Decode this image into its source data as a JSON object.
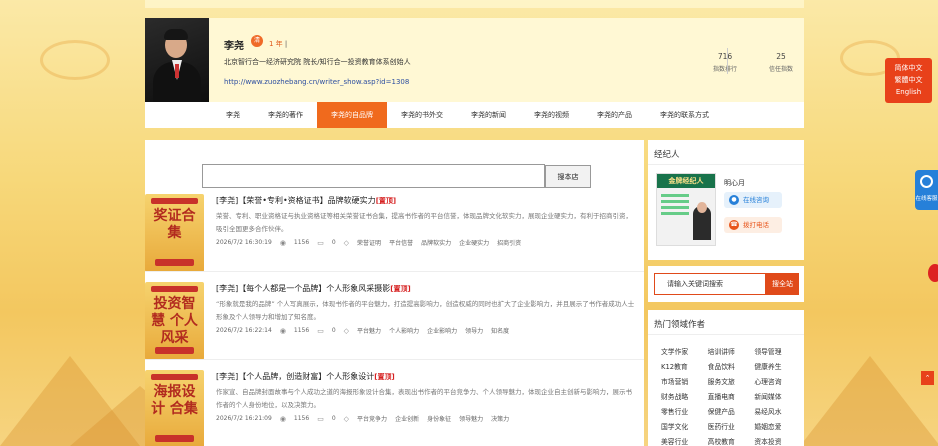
{
  "profile": {
    "name": "李尧",
    "badge": "清",
    "years": "1 年",
    "years_sep": "|",
    "description": "北京智行合一经济研究院 院长/知行合一投资教育体系创始人",
    "url": "http://www.zuozhebang.cn/writer_show.asp?id=1308",
    "stats": [
      {
        "value": "716",
        "label": "指数排行"
      },
      {
        "value": "25",
        "label": "信任指数"
      }
    ]
  },
  "nav": {
    "items": [
      "李尧",
      "李尧的著作",
      "李尧的自品牌",
      "李尧的书外交",
      "李尧的新闻",
      "李尧的视频",
      "李尧的产品",
      "李尧的联系方式"
    ],
    "active_index": 2
  },
  "search": {
    "placeholder": "",
    "button": "搜本店"
  },
  "articles": [
    {
      "cover": {
        "top": "",
        "main": "奖证合集",
        "bottom": ""
      },
      "title": "[李尧]【荣誉•专利•资格证书】品牌软硬实力",
      "tag": "[置顶]",
      "body": "荣誉、专利、职业资格证与执业资格证等相关荣誉证书合集，提高书作者的平台信誉，体现品牌文化软实力，展现企业硬实力，有利于招商引资，吸引全国更多合作伙伴。",
      "date": "2026/7/2 16:30:19",
      "views": "1156",
      "comments": "0",
      "tags": [
        "荣誉证明",
        "平台信誉",
        "品牌软实力",
        "企业硬实力",
        "招商引资"
      ]
    },
    {
      "cover": {
        "top": "",
        "main": "投资智慧 个人风采",
        "bottom": ""
      },
      "title": "[李尧]【每个人都是一个品牌】个人形象风采摄影",
      "tag": "[置顶]",
      "body": "“形象就是我的品牌” 个人写真展示，体现书作者的平台魅力，打造提高影响力，创造权威的同时也扩大了企业影响力，并且展示了书作者成功人士形象及个人领导力和增加了知名度。",
      "date": "2026/7/2 16:22:14",
      "views": "1156",
      "comments": "0",
      "tags": [
        "平台魅力",
        "个人影响力",
        "企业影响力",
        "领导力",
        "知名度"
      ]
    },
    {
      "cover": {
        "top": "",
        "main": "海报设计 合集",
        "bottom": ""
      },
      "title": "[李尧]【个人品牌，创造财富】个人形象设计",
      "tag": "[置顶]",
      "body": "作家宣、自品牌封面故事与个人成功之道的海报形象设计合集，表现出书作者的平台竞争力、个人领导魅力，体现企业自主创新与影响力，展示书作者的个人身份地位，以及决策力。",
      "date": "2026/7/2 16:21:09",
      "views": "1156",
      "comments": "0",
      "tags": [
        "平台竞争力",
        "企业创新",
        "身份象征",
        "领导魅力",
        "决策力"
      ]
    }
  ],
  "agent": {
    "heading": "经纪人",
    "card_title": "金牌经纪人",
    "name": "明心月",
    "consult": "在线咨询",
    "call": "拨打电话"
  },
  "keyword": {
    "placeholder": "请输入关键词搜索",
    "button": "搜全站"
  },
  "hot": {
    "heading": "热门领域作者",
    "items": [
      "文学作家",
      "培训讲师",
      "领导管理",
      "K12教育",
      "食品饮料",
      "健康养生",
      "市场营销",
      "服务文旅",
      "心理咨询",
      "财务战略",
      "直播电商",
      "新闻媒体",
      "零售行业",
      "保健产品",
      "易经风水",
      "国学文化",
      "医药行业",
      "婚姻恋爱",
      "美容行业",
      "高校教育",
      "资本投资"
    ]
  },
  "lang": {
    "simplified": "简体中文",
    "traditional": "繁體中文",
    "english": "English"
  },
  "online_service": "在线客服",
  "colors": {
    "accent": "#f06a1d",
    "link": "#2d4fa0",
    "top_tag": "#d62020"
  }
}
